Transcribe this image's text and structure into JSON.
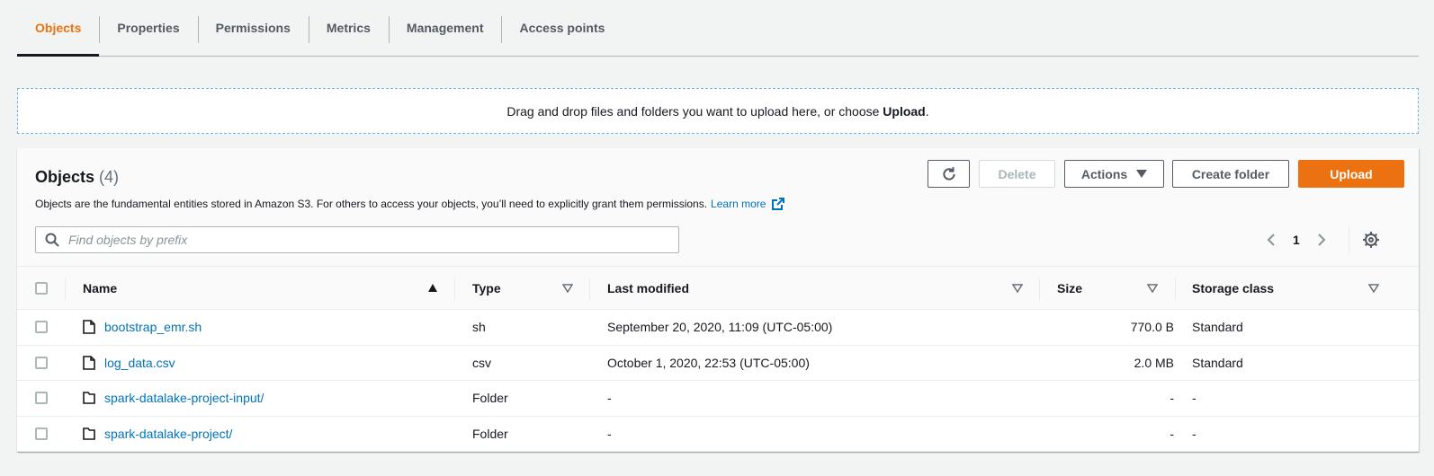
{
  "tabs": [
    {
      "label": "Objects",
      "active": true
    },
    {
      "label": "Properties"
    },
    {
      "label": "Permissions"
    },
    {
      "label": "Metrics"
    },
    {
      "label": "Management"
    },
    {
      "label": "Access points"
    }
  ],
  "dropzone": {
    "text_before": "Drag and drop files and folders you want to upload here, or choose ",
    "bold": "Upload",
    "text_after": "."
  },
  "objects_panel": {
    "title": "Objects",
    "count": "(4)",
    "description": "Objects are the fundamental entities stored in Amazon S3. For others to access your objects, you’ll need to explicitly grant them permissions.",
    "learn_more": "Learn more",
    "buttons": {
      "delete": "Delete",
      "actions": "Actions",
      "create_folder": "Create folder",
      "upload": "Upload"
    },
    "search_placeholder": "Find objects by prefix",
    "page": "1"
  },
  "table": {
    "columns": {
      "name": "Name",
      "type": "Type",
      "last_modified": "Last modified",
      "size": "Size",
      "storage_class": "Storage class"
    },
    "rows": [
      {
        "name": "bootstrap_emr.sh",
        "kind": "file",
        "type": "sh",
        "last_modified": "September 20, 2020, 11:09 (UTC-05:00)",
        "size": "770.0 B",
        "storage_class": "Standard"
      },
      {
        "name": "log_data.csv",
        "kind": "file",
        "type": "csv",
        "last_modified": "October 1, 2020, 22:53 (UTC-05:00)",
        "size": "2.0 MB",
        "storage_class": "Standard"
      },
      {
        "name": "spark-datalake-project-input/",
        "kind": "folder",
        "type": "Folder",
        "last_modified": "-",
        "size": "-",
        "storage_class": "-"
      },
      {
        "name": "spark-datalake-project/",
        "kind": "folder",
        "type": "Folder",
        "last_modified": "-",
        "size": "-",
        "storage_class": "-"
      }
    ]
  },
  "colors": {
    "accent": "#ec7211",
    "link": "#0073bb",
    "text": "#16191f",
    "muted": "#545b64"
  }
}
